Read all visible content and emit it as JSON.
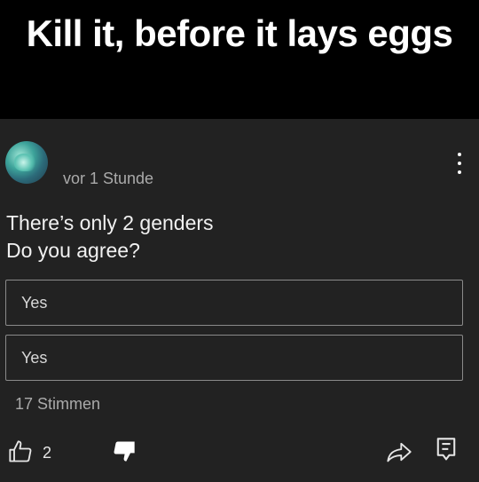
{
  "banner": {
    "title": "Kill it, before it lays eggs"
  },
  "post": {
    "timestamp": "vor 1 Stunde",
    "text_line1": "There’s only 2 genders",
    "text_line2": "Do you agree?",
    "poll": {
      "options": [
        {
          "label": "Yes"
        },
        {
          "label": "Yes"
        }
      ],
      "votes": "17 Stimmen"
    },
    "actions": {
      "like_count": "2",
      "icons": [
        "thumbs-up-icon",
        "thumbs-down-icon",
        "share-icon",
        "comment-icon",
        "more-vert-icon"
      ]
    }
  },
  "colors": {
    "background": "#212121",
    "banner": "#000000",
    "text": "#f1f1f1",
    "secondary_text": "#aaaaaa",
    "option_border": "#8a8a8a"
  }
}
